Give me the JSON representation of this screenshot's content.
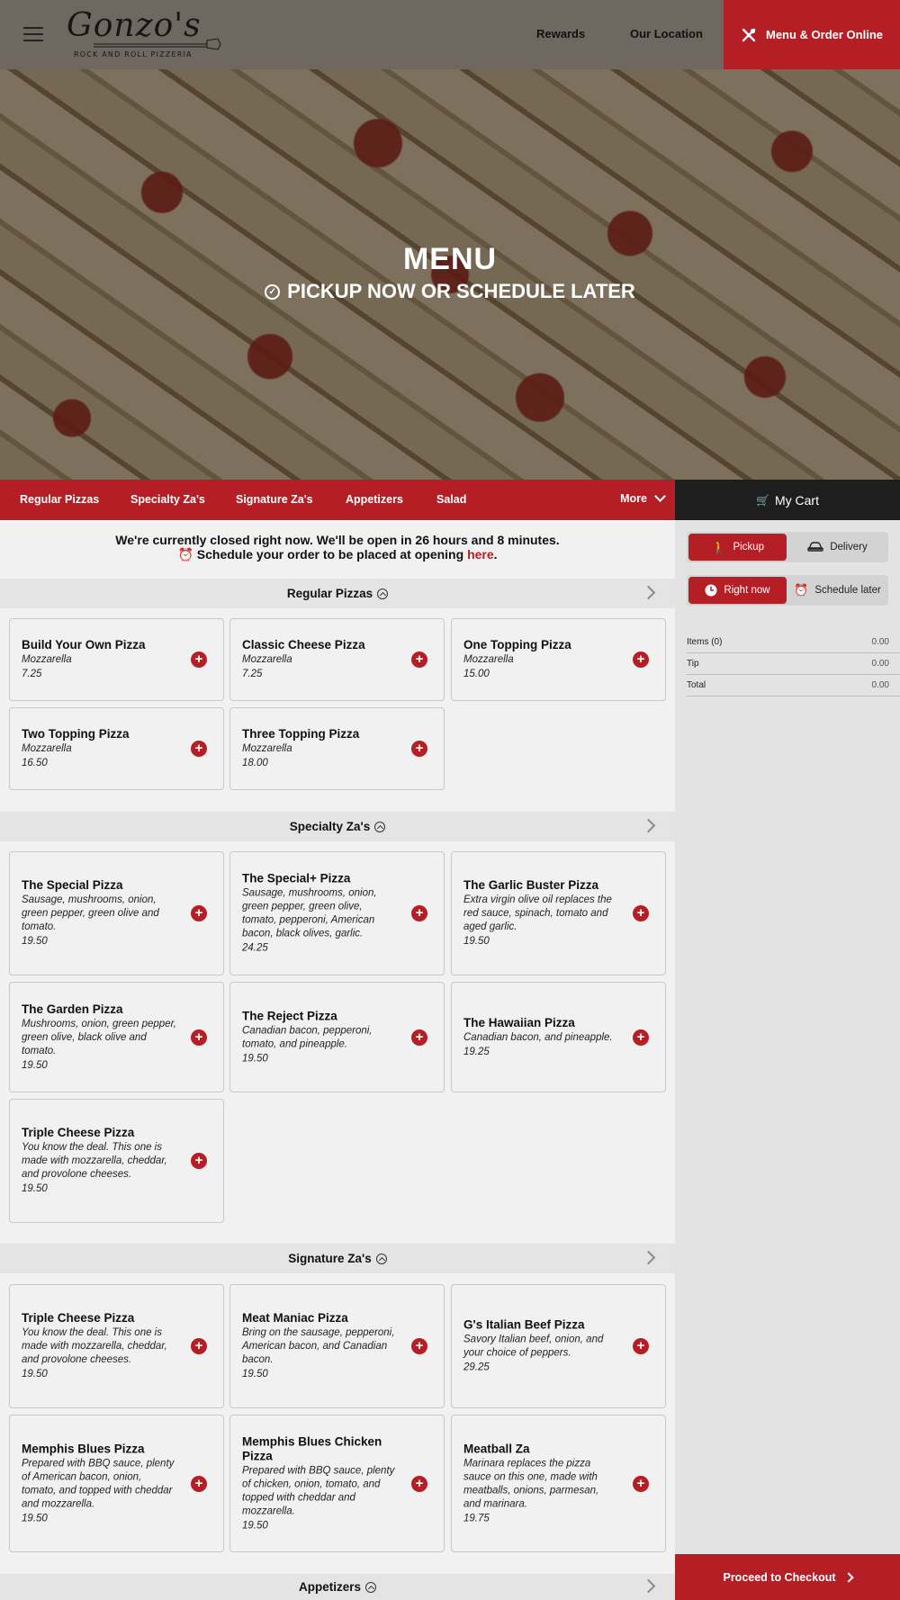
{
  "header": {
    "logo_name": "Gonzo's",
    "logo_tagline": "ROCK AND ROLL PIZZERIA",
    "nav": [
      "Rewards",
      "Our Location"
    ],
    "order_button": "Menu & Order Online"
  },
  "hero": {
    "title": "MENU",
    "subtitle": "PICKUP NOW OR SCHEDULE LATER"
  },
  "category_bar": {
    "items": [
      "Regular Pizzas",
      "Specialty Za's",
      "Signature Za's",
      "Appetizers",
      "Salad"
    ],
    "more": "More"
  },
  "cart": {
    "title": "My Cart",
    "fulfillment": [
      "Pickup",
      "Delivery"
    ],
    "timing": [
      "Right now",
      "Schedule later"
    ],
    "rows": [
      {
        "label": "Items (0)",
        "value": "0.00"
      },
      {
        "label": "Tip",
        "value": "0.00"
      },
      {
        "label": "Total",
        "value": "0.00"
      }
    ],
    "checkout": "Proceed to Checkout"
  },
  "notice": {
    "line1": "We're currently closed right now. We'll be open in 26 hours and 8 minutes.",
    "line2_prefix": "Schedule your order to be placed at opening ",
    "link": "here",
    "line2_suffix": "."
  },
  "sections": [
    {
      "title": "Regular Pizzas",
      "items": [
        {
          "name": "Build Your Own Pizza",
          "desc": "Mozzarella",
          "price": "7.25"
        },
        {
          "name": "Classic Cheese Pizza",
          "desc": "Mozzarella",
          "price": "7.25"
        },
        {
          "name": "One Topping Pizza",
          "desc": "Mozzarella",
          "price": "15.00"
        },
        {
          "name": "Two Topping Pizza",
          "desc": "Mozzarella",
          "price": "16.50"
        },
        {
          "name": "Three Topping Pizza",
          "desc": "Mozzarella",
          "price": "18.00"
        }
      ]
    },
    {
      "title": "Specialty Za's",
      "items": [
        {
          "name": "The Special Pizza",
          "desc": "Sausage, mushrooms, onion, green pepper, green olive and tomato.",
          "price": "19.50"
        },
        {
          "name": "The Special+ Pizza",
          "desc": "Sausage, mushrooms, onion, green pepper, green olive, tomato, pepperoni, American bacon, black olives, garlic.",
          "price": "24.25"
        },
        {
          "name": "The Garlic Buster Pizza",
          "desc": "Extra virgin olive oil replaces the red sauce, spinach, tomato and aged garlic.",
          "price": "19.50"
        },
        {
          "name": "The Garden Pizza",
          "desc": "Mushrooms, onion, green pepper, green olive, black olive and tomato.",
          "price": "19.50"
        },
        {
          "name": "The Reject Pizza",
          "desc": "Canadian bacon, pepperoni, tomato, and pineapple.",
          "price": "19.50"
        },
        {
          "name": "The Hawaiian Pizza",
          "desc": "Canadian bacon, and pineapple.",
          "price": "19.25"
        },
        {
          "name": "Triple Cheese Pizza",
          "desc": "You know the deal. This one is made with mozzarella, cheddar, and provolone cheeses.",
          "price": "19.50"
        }
      ]
    },
    {
      "title": "Signature Za's",
      "items": [
        {
          "name": "Triple Cheese Pizza",
          "desc": "You know the deal. This one is made with mozzarella, cheddar, and provolone cheeses.",
          "price": "19.50"
        },
        {
          "name": "Meat Maniac Pizza",
          "desc": "Bring on the sausage, pepperoni, American bacon, and Canadian bacon.",
          "price": "19.50"
        },
        {
          "name": "G's Italian Beef Pizza",
          "desc": "Savory Italian beef, onion, and your choice of peppers.",
          "price": "29.25"
        },
        {
          "name": "Memphis Blues Pizza",
          "desc": "Prepared with BBQ sauce, plenty of American bacon, onion, tomato, and topped with cheddar and mozzarella.",
          "price": "19.50"
        },
        {
          "name": "Memphis Blues Chicken Pizza",
          "desc": "Prepared with BBQ sauce, plenty of chicken, onion, tomato, and topped with cheddar and mozzarella.",
          "price": "19.50"
        },
        {
          "name": "Meatball Za",
          "desc": "Marinara replaces the pizza sauce on this one, made with meatballs, onions, parmesan, and marinara.",
          "price": "19.75"
        }
      ]
    },
    {
      "title": "Appetizers",
      "items": []
    }
  ],
  "colors": {
    "brand_red": "#b61e25",
    "dark": "#1e1e1e"
  }
}
